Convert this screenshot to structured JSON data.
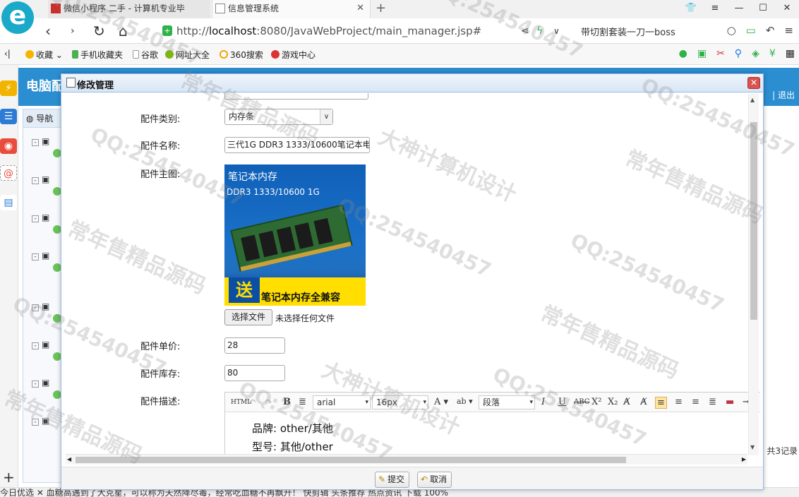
{
  "browser": {
    "tabs": [
      {
        "label": "微信小程序 二手 - 计算机专业毕"
      },
      {
        "label": "信息管理系统"
      }
    ],
    "url_host": "localhost",
    "url_prefix": "http://",
    "url_rest": ":8080/JavaWebProject/main_manager.jsp#",
    "search_text": "带切割套装一刀一boss",
    "bookmarks": [
      "收藏",
      "手机收藏夹",
      "谷歌",
      "网址大全",
      "360搜索",
      "游戏中心"
    ]
  },
  "app": {
    "name": "电脑配",
    "logout": "| 退出",
    "nav_header": "导航",
    "total_text": "共3记录"
  },
  "dialog": {
    "title": "修改管理",
    "labels": {
      "category": "配件类别:",
      "name": "配件名称:",
      "image": "配件主图:",
      "price": "配件单价:",
      "stock": "配件库存:",
      "description": "配件描述:"
    },
    "fields": {
      "category": "内存条",
      "name": "三代1G DDR3 1333/10600笔记本电",
      "price": "28",
      "stock": "80"
    },
    "file_button": "选择文件",
    "file_status": "未选择任何文件",
    "product_image_text": {
      "line1": "笔记本内存",
      "line2": "DDR3 1333/10600 1G",
      "gift": "送",
      "line3": "笔记本内存全兼容"
    },
    "editor": {
      "font": "arial",
      "size": "16px",
      "paragraph": "段落",
      "lines": [
        "品牌: other/其他",
        "型号: 其他/other"
      ]
    },
    "buttons": {
      "submit": "提交",
      "cancel": "取消"
    }
  },
  "status": "今日优选   ✕  血糖高遇到了大克星，可以称为天然降尽毒，经常吃血糖不再飘升！   快剪辑   头条推荐   热点资讯          下载          100%",
  "watermarks": [
    "QQ:254540457",
    "大神计算机设计",
    "常年售精品源码"
  ]
}
